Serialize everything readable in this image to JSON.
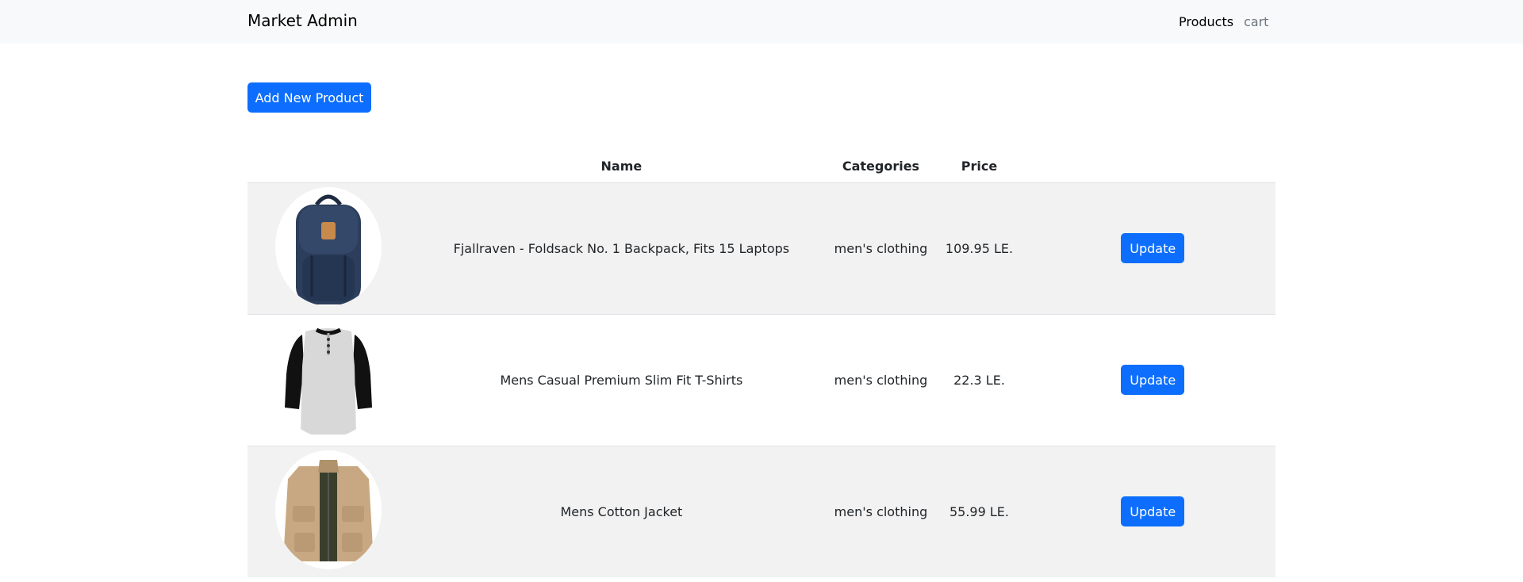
{
  "navbar": {
    "brand": "Market Admin",
    "links": [
      "Products",
      "cart"
    ]
  },
  "actions": {
    "add_label": "Add New Product"
  },
  "table": {
    "headers": [
      "",
      "Name",
      "Categories",
      "Price",
      ""
    ],
    "rows": [
      {
        "image": "backpack-image",
        "name": "Fjallraven - Foldsack No. 1 Backpack, Fits 15 Laptops",
        "category": "men's clothing",
        "price": "109.95 LE.",
        "action": "Update"
      },
      {
        "image": "t-shirt-image",
        "name": "Mens Casual Premium Slim Fit T-Shirts",
        "category": "men's clothing",
        "price": "22.3 LE.",
        "action": "Update"
      },
      {
        "image": "jacket-image",
        "name": "Mens Cotton Jacket",
        "category": "men's clothing",
        "price": "55.99 LE.",
        "action": "Update"
      }
    ]
  },
  "colors": {
    "primary": "#0d6efd",
    "navbar_bg": "#f8f9fa",
    "stripe": "#f2f2f2"
  }
}
